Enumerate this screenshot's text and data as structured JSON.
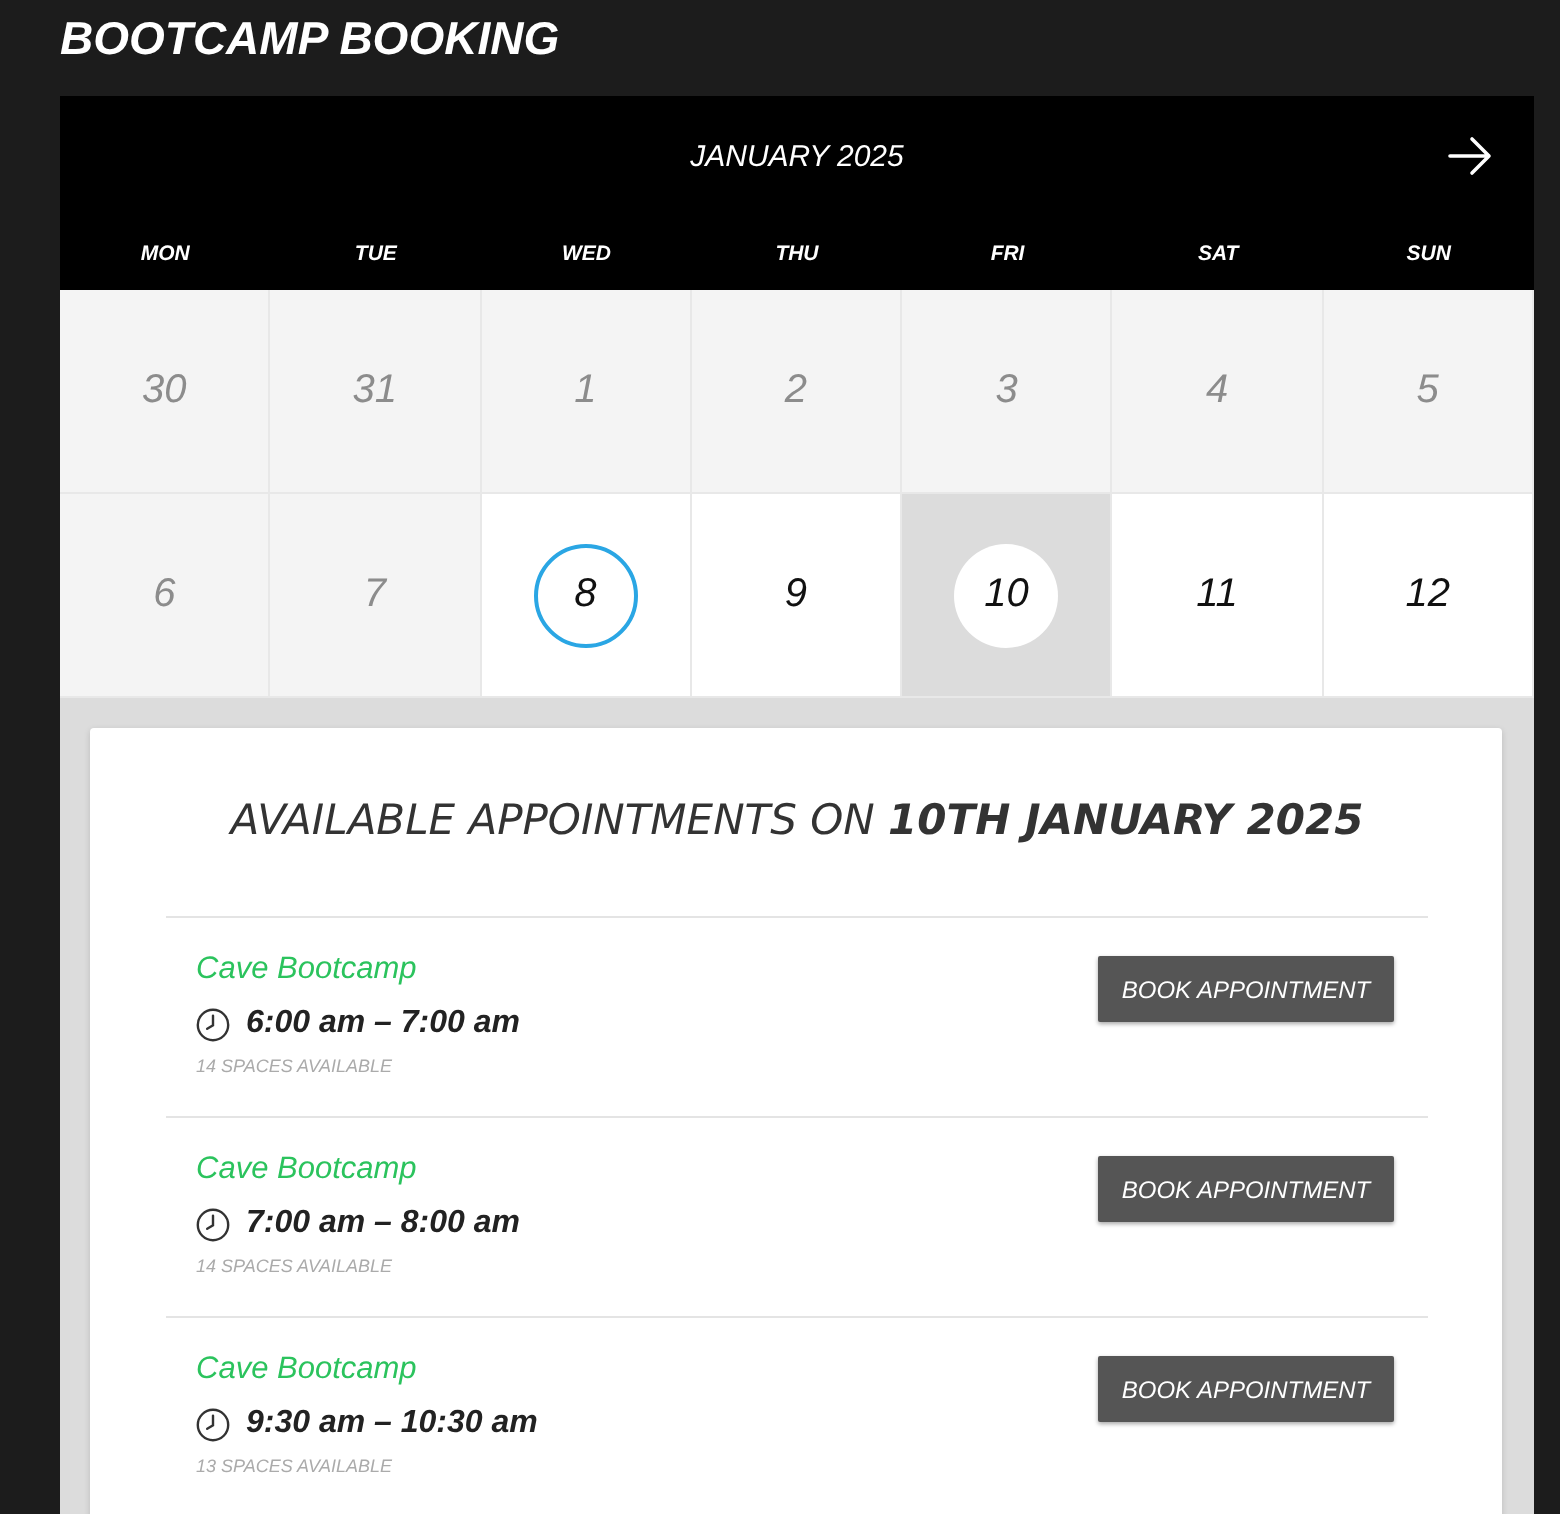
{
  "page": {
    "title": "BOOTCAMP BOOKING"
  },
  "calendar": {
    "month": "JANUARY 2025",
    "weekdays": [
      "MON",
      "TUE",
      "WED",
      "THU",
      "FRI",
      "SAT",
      "SUN"
    ],
    "days": [
      {
        "label": "30",
        "disabled": true,
        "today": false,
        "selected": false
      },
      {
        "label": "31",
        "disabled": true,
        "today": false,
        "selected": false
      },
      {
        "label": "1",
        "disabled": true,
        "today": false,
        "selected": false
      },
      {
        "label": "2",
        "disabled": true,
        "today": false,
        "selected": false
      },
      {
        "label": "3",
        "disabled": true,
        "today": false,
        "selected": false
      },
      {
        "label": "4",
        "disabled": true,
        "today": false,
        "selected": false
      },
      {
        "label": "5",
        "disabled": true,
        "today": false,
        "selected": false
      },
      {
        "label": "6",
        "disabled": true,
        "today": false,
        "selected": false
      },
      {
        "label": "7",
        "disabled": true,
        "today": false,
        "selected": false
      },
      {
        "label": "8",
        "disabled": false,
        "today": true,
        "selected": false
      },
      {
        "label": "9",
        "disabled": false,
        "today": false,
        "selected": false
      },
      {
        "label": "10",
        "disabled": false,
        "today": false,
        "selected": true
      },
      {
        "label": "11",
        "disabled": false,
        "today": false,
        "selected": false
      },
      {
        "label": "12",
        "disabled": false,
        "today": false,
        "selected": false
      }
    ]
  },
  "appointments": {
    "heading": "AVAILABLE APPOINTMENTS ON **10TH JANUARY 2025**",
    "slots": [
      {
        "name": "Cave Bootcamp",
        "time": "6:00 am – 7:00 am",
        "spaces": "14 SPACES AVAILABLE",
        "button": "BOOK APPOINTMENT"
      },
      {
        "name": "Cave Bootcamp",
        "time": "7:00 am – 8:00 am",
        "spaces": "14 SPACES AVAILABLE",
        "button": "BOOK APPOINTMENT"
      },
      {
        "name": "Cave Bootcamp",
        "time": "9:30 am – 10:30 am",
        "spaces": "13 SPACES AVAILABLE",
        "button": "BOOK APPOINTMENT"
      }
    ]
  }
}
